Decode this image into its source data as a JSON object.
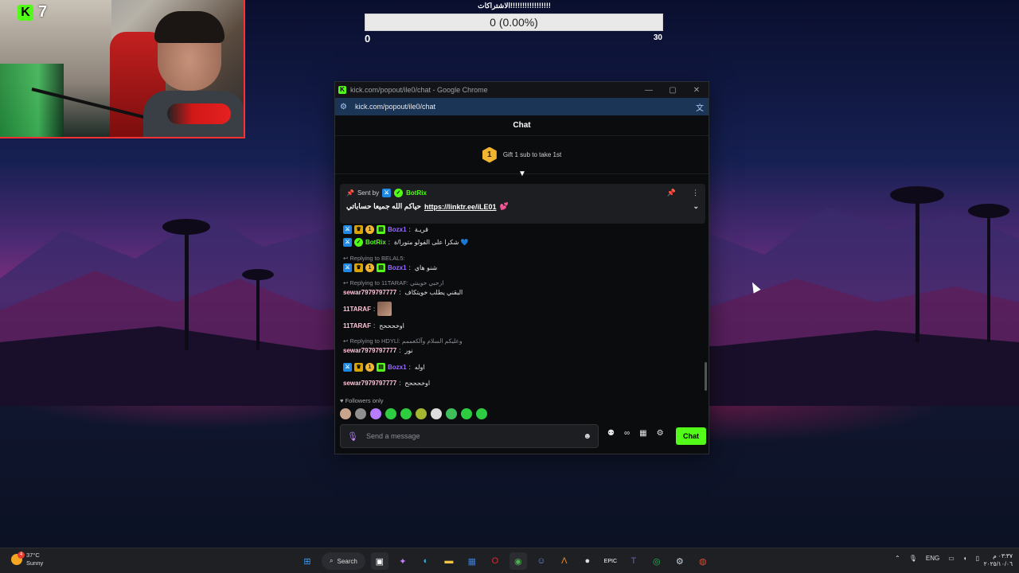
{
  "overlay": {
    "kick_count": "7",
    "goal_title": "الاشتراكات!!!!!!!!!!!!!!!!!",
    "goal_progress": "0 (0.00%)",
    "goal_progress_fraction": 0,
    "goal_min": "0",
    "goal_max": "30"
  },
  "browser": {
    "window_title": "kick.com/popout/ile0/chat - Google Chrome",
    "url": "kick.com/popout/ile0/chat",
    "controls": {
      "minimize": "—",
      "maximize": "▢",
      "close": "✕"
    }
  },
  "chat": {
    "header": "Chat",
    "gift_tier": "1",
    "gift_text": "Gift 1 sub to take 1st",
    "pinned": {
      "sent_by_label": "Sent by",
      "sender": "BotRix",
      "message": "حياكم الله جميعا حساباتي",
      "link": "https://linktr.ee/iLE01",
      "emote": "💕"
    },
    "messages": [
      {
        "type": "msg",
        "user": "Bozx1",
        "color": "purple",
        "badges": [
          "mod",
          "og",
          "tier",
          "sub"
        ],
        "text": "قريـة"
      },
      {
        "type": "msg",
        "user": "BotRix",
        "color": "green",
        "badges": [
          "mod",
          "ver"
        ],
        "text": "شكرا على الفولو متورا/ة 💙"
      },
      {
        "type": "reply",
        "text": "Replying to BELAL5:"
      },
      {
        "type": "msg",
        "user": "Bozx1",
        "color": "purple",
        "badges": [
          "mod",
          "og",
          "tier",
          "sub"
        ],
        "text": "شنو هاي"
      },
      {
        "type": "reply",
        "text": "Replying to 11TARAF: ارحبي حوينتي"
      },
      {
        "type": "msg",
        "user": "sewar7979797777",
        "color": "pink",
        "badges": [],
        "text": "البقني يطلب خويتكاف"
      },
      {
        "type": "msg",
        "user": "11TARAF",
        "color": "pink",
        "badges": [],
        "text": "",
        "avatar": true
      },
      {
        "type": "msg",
        "user": "11TARAF",
        "color": "pink",
        "badges": [],
        "text": "اوخحححح"
      },
      {
        "type": "reply",
        "text": "Replying to HDYLl: وعليكم السلام وآلكعممم"
      },
      {
        "type": "msg",
        "user": "sewar7979797777",
        "color": "pink",
        "badges": [],
        "text": "نور"
      },
      {
        "type": "msg",
        "user": "Bozx1",
        "color": "purple",
        "badges": [
          "mod",
          "og",
          "tier",
          "sub"
        ],
        "text": "اوله"
      },
      {
        "type": "msg",
        "user": "sewar7979797777",
        "color": "pink",
        "badges": [],
        "text": "اوخحححح"
      }
    ],
    "followers_only": "Followers only",
    "input_placeholder": "Send a message",
    "send_label": "Chat"
  },
  "taskbar": {
    "temperature": "37°C",
    "condition": "Sunny",
    "weather_alert": "4",
    "search_label": "Search",
    "language": "ENG",
    "time": "٠٣:٣٧ م",
    "date": "٢٠٢٥/١٠/٠٦"
  }
}
